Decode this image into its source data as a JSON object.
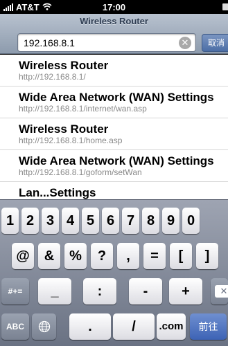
{
  "status_bar": {
    "carrier": "AT&T",
    "time": "17:00",
    "wifi_icon": "wifi-icon",
    "signal_icon": "signal-bars-icon",
    "battery_icon": "battery-icon"
  },
  "header": {
    "page_title": "Wireless Router",
    "url_value": "192.168.8.1",
    "cancel_label": "取消",
    "clear_icon": "clear-text-icon"
  },
  "suggestions": [
    {
      "title": "Wireless Router",
      "url": "http://192.168.8.1/"
    },
    {
      "title": "Wide Area Network (WAN) Settings",
      "url": "http://192.168.8.1/internet/wan.asp"
    },
    {
      "title": "Wireless Router",
      "url": "http://192.168.8.1/home.asp"
    },
    {
      "title": "Wide Area Network (WAN) Settings",
      "url": "http://192.168.8.1/goform/setWan"
    },
    {
      "title": "Lan...Settings",
      "url": ""
    }
  ],
  "keyboard": {
    "row1": [
      "1",
      "2",
      "3",
      "4",
      "5",
      "6",
      "7",
      "8",
      "9",
      "0"
    ],
    "row2": [
      "@",
      "&",
      "%",
      "?",
      ",",
      "=",
      "[",
      "]"
    ],
    "row3": [
      "#+=",
      "_",
      ":",
      "-",
      "+"
    ],
    "row4": {
      "abc": "ABC",
      "dot": ".",
      "slash": "/",
      "dotcom": ".com",
      "go": "前往"
    },
    "delete_icon": "delete-backspace-icon",
    "globe_icon": "globe-icon"
  },
  "colors": {
    "header_gradient_top": "#b8c2cf",
    "header_gradient_bottom": "#8d9bad",
    "cancel_button": "#4c6ea6",
    "go_key": "#3d63b5",
    "keyboard_bg": "#7d8494"
  }
}
